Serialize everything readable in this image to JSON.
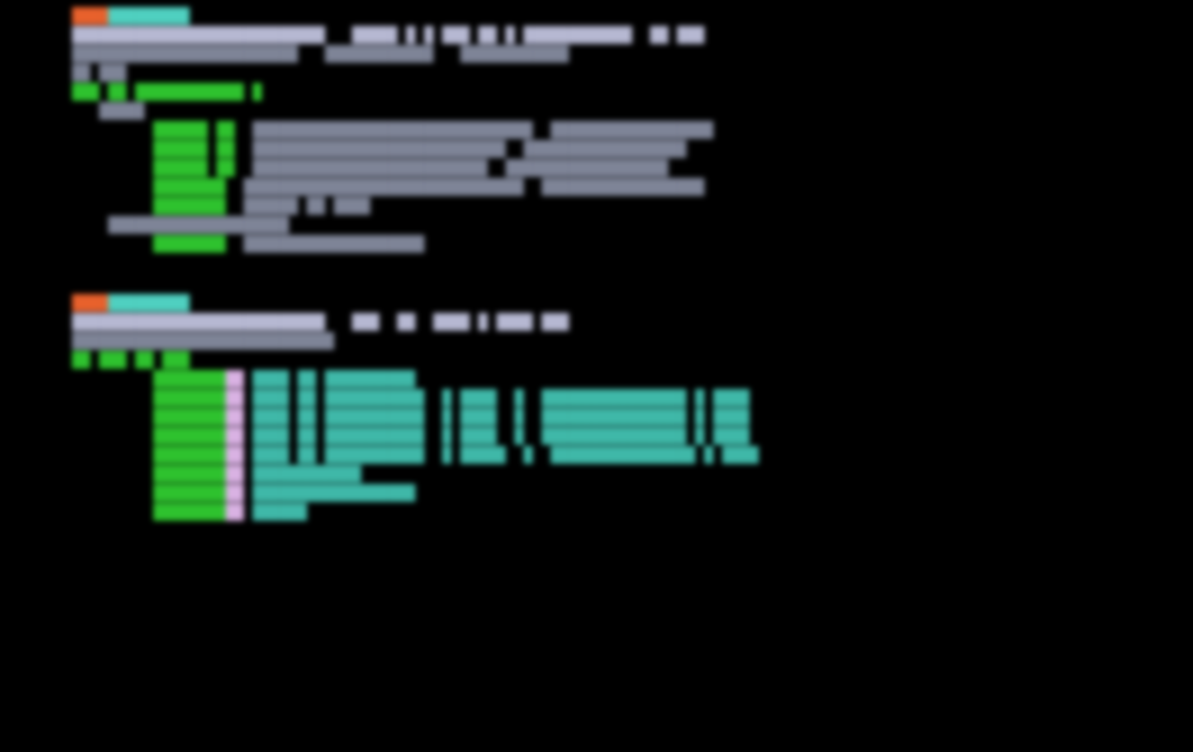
{
  "editor": {
    "theme_colors": {
      "background": "#000000",
      "line_number": "#2ec22e",
      "keyword": "#e8612c",
      "identifier": "#b6b8d2",
      "string": "#3fb8a8",
      "highlight": "#5a1a63"
    },
    "lines": [
      {
        "gutter": "",
        "segments": [
          {
            "cls": "kw-orange",
            "text": "████"
          },
          {
            "cls": "fn-cyan",
            "text": "█████████"
          }
        ]
      },
      {
        "gutter": "",
        "segments": [
          {
            "cls": "ident",
            "text": "████████████████████████████   █████ █ █ ███ ██ █ ████████████  ██ ███"
          }
        ]
      },
      {
        "gutter": "",
        "segments": [
          {
            "cls": "dim",
            "text": "█████████████████████████   ████████████   ████████████"
          }
        ]
      },
      {
        "gutter": "",
        "segments": [
          {
            "cls": "dim",
            "text": "██ ███"
          }
        ]
      },
      {
        "gutter": "",
        "segments": [
          {
            "cls": "green",
            "text": "███ ██ ████████████ █"
          }
        ]
      },
      {
        "gutter": "",
        "segments": [
          {
            "cls": "dim",
            "text": "   █████"
          }
        ]
      },
      {
        "gutter": "",
        "segments": [
          {
            "cls": "green",
            "text": "         ██████ ██"
          },
          {
            "cls": "dim",
            "text": "  ███████████████████████████████  ██████████████████"
          }
        ]
      },
      {
        "gutter": "",
        "segments": [
          {
            "cls": "green",
            "text": "         ██████ ██"
          },
          {
            "cls": "dim",
            "text": "  ████████████████████████████  ██████████████████"
          }
        ]
      },
      {
        "gutter": "",
        "segments": [
          {
            "cls": "green",
            "text": "         ██████ ██"
          },
          {
            "cls": "dim",
            "text": "  ██████████████████████████  ██████████████████"
          }
        ]
      },
      {
        "gutter": "",
        "segments": [
          {
            "cls": "green",
            "text": "         ████████"
          },
          {
            "cls": "dim",
            "text": "  ███████████████████████████████  ██████████████████"
          }
        ]
      },
      {
        "gutter": "",
        "segments": [
          {
            "cls": "green",
            "text": "         ████████"
          },
          {
            "cls": "dim",
            "text": "  ██████ ██ ████"
          }
        ]
      },
      {
        "gutter": "",
        "segments": [
          {
            "cls": "dim",
            "text": "    ████████████████████"
          }
        ]
      },
      {
        "gutter": "",
        "segments": [
          {
            "cls": "green",
            "text": "         ████████"
          },
          {
            "cls": "dim",
            "text": "  ████████████████████"
          }
        ]
      },
      {
        "gutter": "",
        "segments": [
          {
            "cls": "kw-orange",
            "text": "████"
          },
          {
            "cls": "fn-cyan",
            "text": "█████████"
          }
        ]
      },
      {
        "gutter": "",
        "segments": [
          {
            "cls": "ident",
            "text": "████████████████████████████   ███  ██  ████ █ ████ ███"
          }
        ]
      },
      {
        "gutter": "",
        "segments": [
          {
            "cls": "dim",
            "text": "█████████████████████████████"
          }
        ]
      },
      {
        "gutter": "",
        "segments": [
          {
            "cls": "green",
            "text": "██ ███ ██ ███"
          }
        ]
      },
      {
        "gutter": "",
        "segments": [
          {
            "cls": "green",
            "text": "         ████████"
          },
          {
            "cls": "purple",
            "text": "██"
          },
          {
            "cls": "teal",
            "text": " ████ ██ ██████████"
          }
        ]
      },
      {
        "gutter": "",
        "segments": [
          {
            "cls": "green",
            "text": "         ████████"
          },
          {
            "cls": "purple",
            "text": "██"
          },
          {
            "cls": "teal",
            "text": " ████ ██ ███████████  █ ████  █  ████████████████ █ ████"
          }
        ]
      },
      {
        "gutter": "",
        "segments": [
          {
            "cls": "green",
            "text": "         ████████"
          },
          {
            "cls": "purple",
            "text": "██"
          },
          {
            "cls": "teal",
            "text": " ████ ██ ███████████  █ ████  █  ████████████████ █ ████"
          }
        ]
      },
      {
        "gutter": "",
        "segments": [
          {
            "cls": "green",
            "text": "         ████████"
          },
          {
            "cls": "purple",
            "text": "██"
          },
          {
            "cls": "teal",
            "text": " ████ ██ ███████████  █ ████  █  ████████████████ █ ████"
          }
        ]
      },
      {
        "gutter": "",
        "segments": [
          {
            "cls": "green",
            "text": "         ████████"
          },
          {
            "cls": "purple",
            "text": "██"
          },
          {
            "cls": "teal",
            "text": " ████ ██ ███████████  █ █████  █  ████████████████ █ ████"
          }
        ]
      },
      {
        "gutter": "",
        "segments": [
          {
            "cls": "green",
            "text": "         ████████"
          },
          {
            "cls": "purple",
            "text": "██"
          },
          {
            "cls": "teal",
            "text": " ████████████"
          }
        ]
      },
      {
        "gutter": "",
        "segments": [
          {
            "cls": "green",
            "text": "         ████████"
          },
          {
            "cls": "purple",
            "text": "██"
          },
          {
            "cls": "teal",
            "text": " ██████████████████"
          }
        ]
      },
      {
        "gutter": "",
        "segments": [
          {
            "cls": "green",
            "text": "         ████████"
          },
          {
            "cls": "purple",
            "text": "██"
          },
          {
            "cls": "teal",
            "text": " ██████"
          }
        ]
      }
    ]
  }
}
